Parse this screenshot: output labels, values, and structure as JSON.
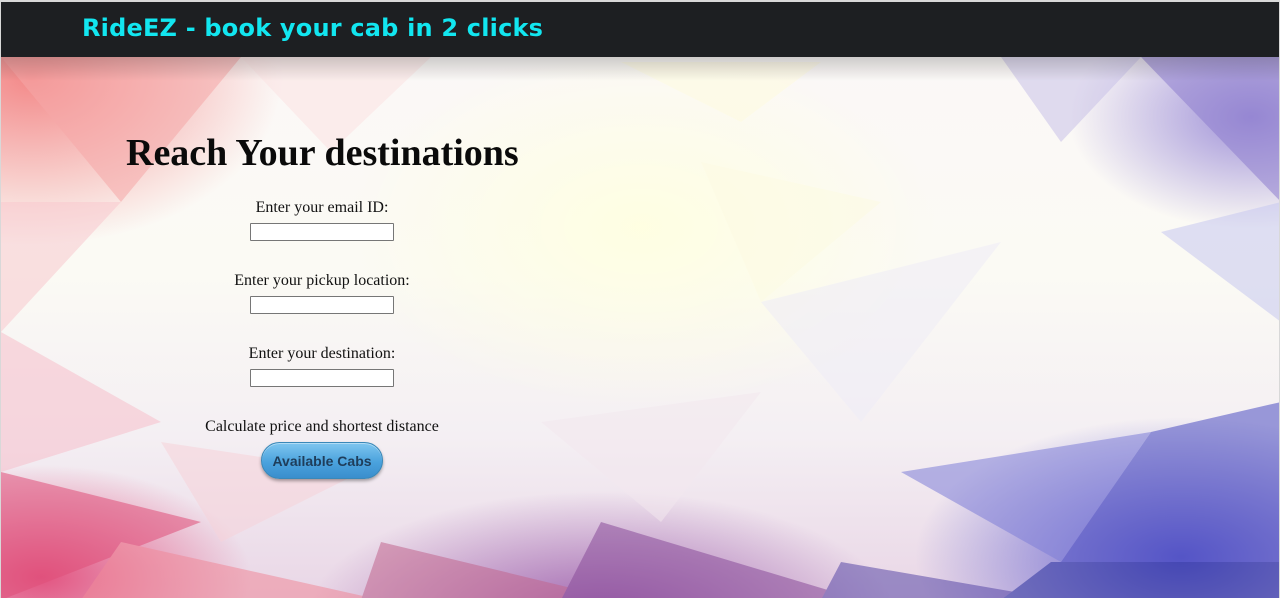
{
  "header": {
    "brand": "RideEZ - book your cab in 2 clicks",
    "brand_color": "#12e6f0",
    "bar_color": "#1d1f22"
  },
  "form": {
    "title": "Reach Your destinations",
    "email_label": "Enter your email ID:",
    "email_value": "",
    "pickup_label": "Enter your pickup location:",
    "pickup_value": "",
    "destination_label": "Enter your destination:",
    "destination_value": "",
    "calc_text": "Calculate price and shortest distance",
    "button_label": "Available Cabs",
    "button_color": "#4aa2dd"
  }
}
